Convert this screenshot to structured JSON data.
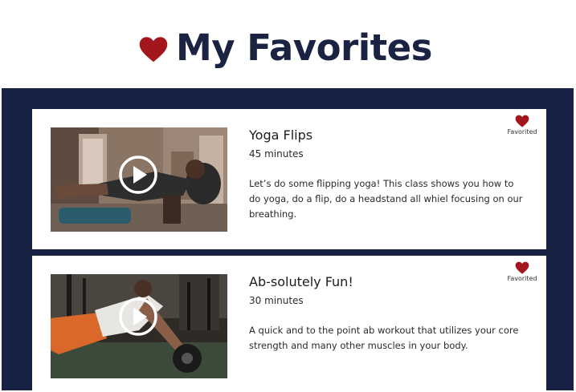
{
  "header": {
    "title": "My Favorites"
  },
  "colors": {
    "navy": "#172143",
    "title_navy": "#1b2343",
    "heart_red": "#a3171c",
    "card_bg": "#ffffff"
  },
  "icons": {
    "header": "heart-icon",
    "play": "play-icon",
    "favorite": "heart-icon"
  },
  "favorites": [
    {
      "title": "Yoga Flips",
      "duration": "45 minutes",
      "description": "Let’s do some flipping yoga! This class shows you how to do yoga, do a flip, do a headstand all whiel focusing on our breathing.",
      "favorite_label": "Favorited"
    },
    {
      "title": "Ab-solutely Fun!",
      "duration": "30 minutes",
      "description": "A quick and to the point ab workout that utilizes your core strength and many other muscles in your body.",
      "favorite_label": "Favorited"
    }
  ]
}
